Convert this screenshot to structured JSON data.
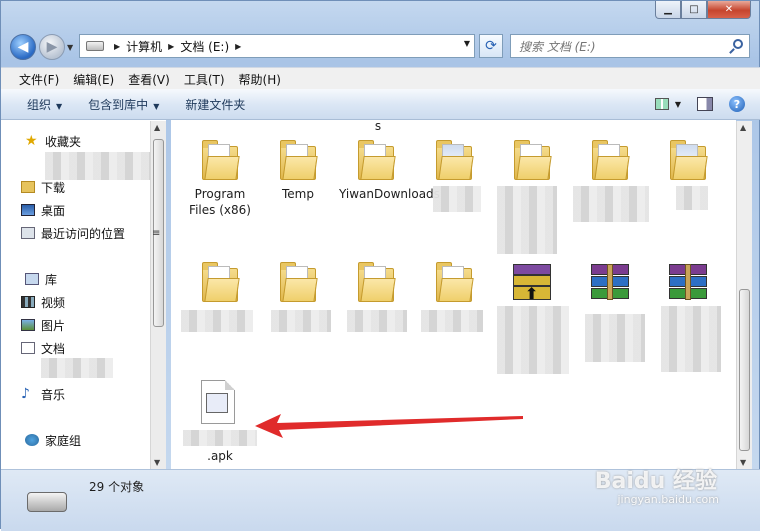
{
  "window": {
    "min_glyph": "▁",
    "max_glyph": "□",
    "close_glyph": "✕"
  },
  "nav": {
    "back_glyph": "◀",
    "forward_glyph": "▶",
    "breadcrumbs": [
      "计算机",
      "文档 (E:)"
    ],
    "refresh_glyph": "⟳"
  },
  "search": {
    "placeholder": "搜索 文档 (E:)"
  },
  "menu": [
    "文件(F)",
    "编辑(E)",
    "查看(V)",
    "工具(T)",
    "帮助(H)"
  ],
  "toolbar": {
    "organize": "组织",
    "include_library": "包含到库中",
    "new_folder": "新建文件夹",
    "help": "?"
  },
  "sidebar": {
    "favorites": {
      "label": "收藏夹",
      "items": [
        "下载",
        "桌面",
        "最近访问的位置"
      ]
    },
    "libraries": {
      "label": "库",
      "items": [
        "视频",
        "图片",
        "文档",
        "音乐"
      ]
    },
    "homegroup": "家庭组"
  },
  "files": {
    "top_partial": "s",
    "row1": [
      "Program Files (x86)",
      "Temp",
      "YiwanDownloads"
    ],
    "apk_label": ".apk",
    "ellipsis": "≡"
  },
  "status": {
    "count_label": "29 个对象"
  },
  "watermark": {
    "brand": "Baidu 经验",
    "url": "jingyan.baidu.com"
  },
  "colors": {
    "arrow": "#e02b2b",
    "accent": "#1e395b"
  }
}
